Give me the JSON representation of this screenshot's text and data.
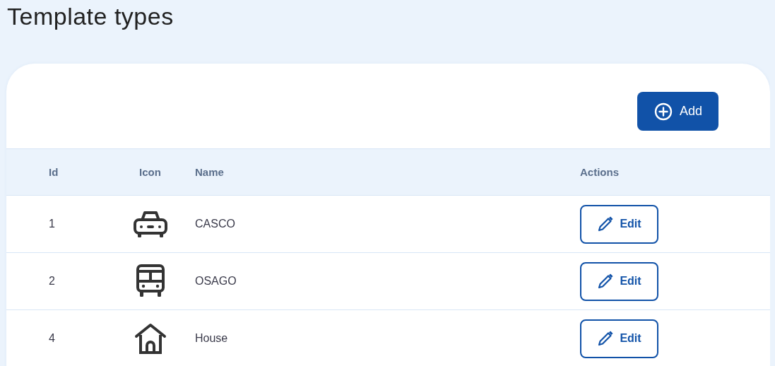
{
  "page": {
    "title": "Template types"
  },
  "toolbar": {
    "add_button": "Add"
  },
  "table": {
    "columns": [
      "Id",
      "Icon",
      "Name",
      "Actions"
    ],
    "rows": [
      {
        "id": "1",
        "icon": {
          "kind": "car"
        },
        "name": "CASCO",
        "action": "Edit"
      },
      {
        "id": "2",
        "icon": {
          "kind": "bus"
        },
        "name": "OSAGO",
        "action": "Edit"
      },
      {
        "id": "4",
        "icon": {
          "kind": "house"
        },
        "name": "House",
        "action": "Edit"
      }
    ]
  }
}
